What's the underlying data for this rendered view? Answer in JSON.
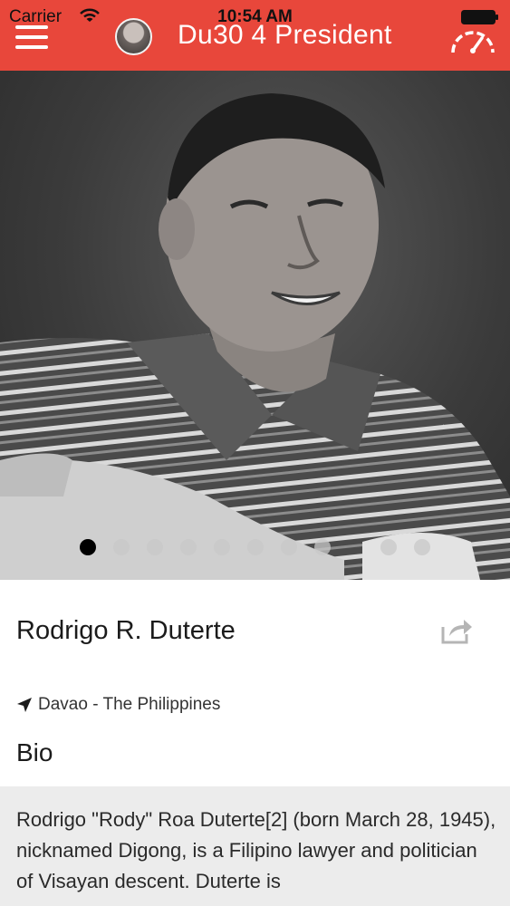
{
  "status_bar": {
    "carrier": "Carrier",
    "time": "10:54 AM"
  },
  "header": {
    "title": "Du30 4 President"
  },
  "carousel": {
    "slide_count": 10,
    "active_index": 0
  },
  "profile": {
    "name": "Rodrigo R. Duterte",
    "location": "Davao - The Philippines"
  },
  "bio": {
    "heading": "Bio",
    "text": "Rodrigo \"Rody\" Roa Duterte[2] (born March 28, 1945), nicknamed Digong, is a Filipino lawyer and politician of Visayan descent. Duterte is"
  },
  "colors": {
    "accent": "#e8473b",
    "panel": "#ececec"
  }
}
